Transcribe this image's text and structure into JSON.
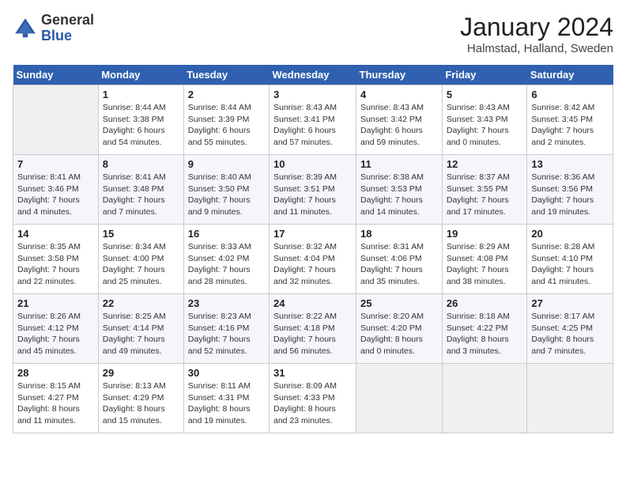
{
  "header": {
    "logo_line1": "General",
    "logo_line2": "Blue",
    "month": "January 2024",
    "location": "Halmstad, Halland, Sweden"
  },
  "days_of_week": [
    "Sunday",
    "Monday",
    "Tuesday",
    "Wednesday",
    "Thursday",
    "Friday",
    "Saturday"
  ],
  "weeks": [
    [
      {
        "day": "",
        "sunrise": "",
        "sunset": "",
        "daylight": ""
      },
      {
        "day": "1",
        "sunrise": "Sunrise: 8:44 AM",
        "sunset": "Sunset: 3:38 PM",
        "daylight": "Daylight: 6 hours and 54 minutes."
      },
      {
        "day": "2",
        "sunrise": "Sunrise: 8:44 AM",
        "sunset": "Sunset: 3:39 PM",
        "daylight": "Daylight: 6 hours and 55 minutes."
      },
      {
        "day": "3",
        "sunrise": "Sunrise: 8:43 AM",
        "sunset": "Sunset: 3:41 PM",
        "daylight": "Daylight: 6 hours and 57 minutes."
      },
      {
        "day": "4",
        "sunrise": "Sunrise: 8:43 AM",
        "sunset": "Sunset: 3:42 PM",
        "daylight": "Daylight: 6 hours and 59 minutes."
      },
      {
        "day": "5",
        "sunrise": "Sunrise: 8:43 AM",
        "sunset": "Sunset: 3:43 PM",
        "daylight": "Daylight: 7 hours and 0 minutes."
      },
      {
        "day": "6",
        "sunrise": "Sunrise: 8:42 AM",
        "sunset": "Sunset: 3:45 PM",
        "daylight": "Daylight: 7 hours and 2 minutes."
      }
    ],
    [
      {
        "day": "7",
        "sunrise": "Sunrise: 8:41 AM",
        "sunset": "Sunset: 3:46 PM",
        "daylight": "Daylight: 7 hours and 4 minutes."
      },
      {
        "day": "8",
        "sunrise": "Sunrise: 8:41 AM",
        "sunset": "Sunset: 3:48 PM",
        "daylight": "Daylight: 7 hours and 7 minutes."
      },
      {
        "day": "9",
        "sunrise": "Sunrise: 8:40 AM",
        "sunset": "Sunset: 3:50 PM",
        "daylight": "Daylight: 7 hours and 9 minutes."
      },
      {
        "day": "10",
        "sunrise": "Sunrise: 8:39 AM",
        "sunset": "Sunset: 3:51 PM",
        "daylight": "Daylight: 7 hours and 11 minutes."
      },
      {
        "day": "11",
        "sunrise": "Sunrise: 8:38 AM",
        "sunset": "Sunset: 3:53 PM",
        "daylight": "Daylight: 7 hours and 14 minutes."
      },
      {
        "day": "12",
        "sunrise": "Sunrise: 8:37 AM",
        "sunset": "Sunset: 3:55 PM",
        "daylight": "Daylight: 7 hours and 17 minutes."
      },
      {
        "day": "13",
        "sunrise": "Sunrise: 8:36 AM",
        "sunset": "Sunset: 3:56 PM",
        "daylight": "Daylight: 7 hours and 19 minutes."
      }
    ],
    [
      {
        "day": "14",
        "sunrise": "Sunrise: 8:35 AM",
        "sunset": "Sunset: 3:58 PM",
        "daylight": "Daylight: 7 hours and 22 minutes."
      },
      {
        "day": "15",
        "sunrise": "Sunrise: 8:34 AM",
        "sunset": "Sunset: 4:00 PM",
        "daylight": "Daylight: 7 hours and 25 minutes."
      },
      {
        "day": "16",
        "sunrise": "Sunrise: 8:33 AM",
        "sunset": "Sunset: 4:02 PM",
        "daylight": "Daylight: 7 hours and 28 minutes."
      },
      {
        "day": "17",
        "sunrise": "Sunrise: 8:32 AM",
        "sunset": "Sunset: 4:04 PM",
        "daylight": "Daylight: 7 hours and 32 minutes."
      },
      {
        "day": "18",
        "sunrise": "Sunrise: 8:31 AM",
        "sunset": "Sunset: 4:06 PM",
        "daylight": "Daylight: 7 hours and 35 minutes."
      },
      {
        "day": "19",
        "sunrise": "Sunrise: 8:29 AM",
        "sunset": "Sunset: 4:08 PM",
        "daylight": "Daylight: 7 hours and 38 minutes."
      },
      {
        "day": "20",
        "sunrise": "Sunrise: 8:28 AM",
        "sunset": "Sunset: 4:10 PM",
        "daylight": "Daylight: 7 hours and 41 minutes."
      }
    ],
    [
      {
        "day": "21",
        "sunrise": "Sunrise: 8:26 AM",
        "sunset": "Sunset: 4:12 PM",
        "daylight": "Daylight: 7 hours and 45 minutes."
      },
      {
        "day": "22",
        "sunrise": "Sunrise: 8:25 AM",
        "sunset": "Sunset: 4:14 PM",
        "daylight": "Daylight: 7 hours and 49 minutes."
      },
      {
        "day": "23",
        "sunrise": "Sunrise: 8:23 AM",
        "sunset": "Sunset: 4:16 PM",
        "daylight": "Daylight: 7 hours and 52 minutes."
      },
      {
        "day": "24",
        "sunrise": "Sunrise: 8:22 AM",
        "sunset": "Sunset: 4:18 PM",
        "daylight": "Daylight: 7 hours and 56 minutes."
      },
      {
        "day": "25",
        "sunrise": "Sunrise: 8:20 AM",
        "sunset": "Sunset: 4:20 PM",
        "daylight": "Daylight: 8 hours and 0 minutes."
      },
      {
        "day": "26",
        "sunrise": "Sunrise: 8:18 AM",
        "sunset": "Sunset: 4:22 PM",
        "daylight": "Daylight: 8 hours and 3 minutes."
      },
      {
        "day": "27",
        "sunrise": "Sunrise: 8:17 AM",
        "sunset": "Sunset: 4:25 PM",
        "daylight": "Daylight: 8 hours and 7 minutes."
      }
    ],
    [
      {
        "day": "28",
        "sunrise": "Sunrise: 8:15 AM",
        "sunset": "Sunset: 4:27 PM",
        "daylight": "Daylight: 8 hours and 11 minutes."
      },
      {
        "day": "29",
        "sunrise": "Sunrise: 8:13 AM",
        "sunset": "Sunset: 4:29 PM",
        "daylight": "Daylight: 8 hours and 15 minutes."
      },
      {
        "day": "30",
        "sunrise": "Sunrise: 8:11 AM",
        "sunset": "Sunset: 4:31 PM",
        "daylight": "Daylight: 8 hours and 19 minutes."
      },
      {
        "day": "31",
        "sunrise": "Sunrise: 8:09 AM",
        "sunset": "Sunset: 4:33 PM",
        "daylight": "Daylight: 8 hours and 23 minutes."
      },
      {
        "day": "",
        "sunrise": "",
        "sunset": "",
        "daylight": ""
      },
      {
        "day": "",
        "sunrise": "",
        "sunset": "",
        "daylight": ""
      },
      {
        "day": "",
        "sunrise": "",
        "sunset": "",
        "daylight": ""
      }
    ]
  ]
}
